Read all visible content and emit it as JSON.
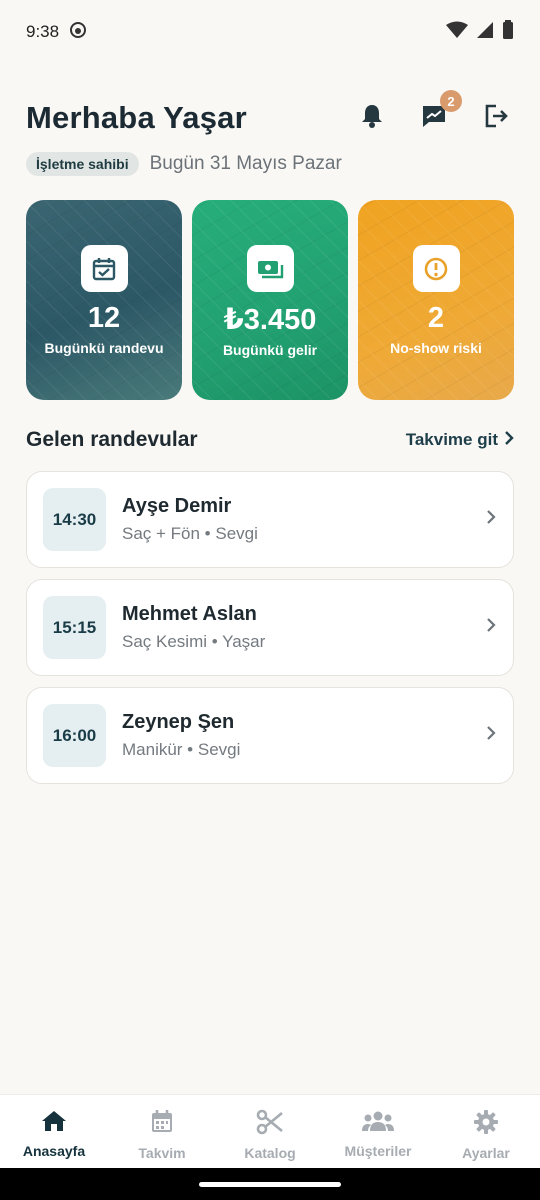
{
  "status_bar": {
    "time": "9:38"
  },
  "header": {
    "greeting": "Merhaba Yaşar",
    "messages_badge": "2"
  },
  "subheader": {
    "role": "İşletme sahibi",
    "date": "Bugün 31 Mayıs Pazar"
  },
  "stats": [
    {
      "value": "12",
      "label": "Bugünkü randevu",
      "icon": "calendar-check-icon",
      "color": "#2c5866"
    },
    {
      "value": "₺3.450",
      "label": "Bugünkü gelir",
      "icon": "cash-icon",
      "color": "#22a071"
    },
    {
      "value": "2",
      "label": "No-show riski",
      "icon": "alert-circle-icon",
      "color": "#efa934"
    }
  ],
  "upcoming": {
    "title": "Gelen randevular",
    "link": "Takvime git",
    "items": [
      {
        "time": "14:30",
        "name": "Ayşe Demir",
        "detail": "Saç + Fön • Sevgi"
      },
      {
        "time": "15:15",
        "name": "Mehmet Aslan",
        "detail": "Saç Kesimi • Yaşar"
      },
      {
        "time": "16:00",
        "name": "Zeynep Şen",
        "detail": "Manikür • Sevgi"
      }
    ]
  },
  "nav": {
    "items": [
      {
        "label": "Anasayfa",
        "icon": "home-icon",
        "active": true
      },
      {
        "label": "Takvim",
        "icon": "calendar-icon",
        "active": false
      },
      {
        "label": "Katalog",
        "icon": "scissors-icon",
        "active": false
      },
      {
        "label": "Müşteriler",
        "icon": "people-icon",
        "active": false
      },
      {
        "label": "Ayarlar",
        "icon": "gear-icon",
        "active": false
      }
    ]
  },
  "colors": {
    "primary": "#16333d",
    "badge": "#d99a6c",
    "background": "#faf8f5"
  }
}
